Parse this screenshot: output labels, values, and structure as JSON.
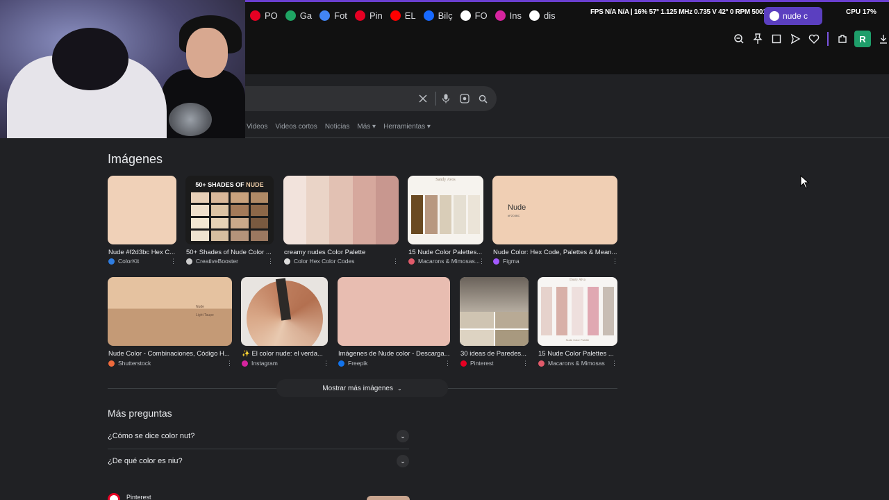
{
  "browser": {
    "bookmarks": [
      {
        "label": "PO",
        "icon": "pinterest-icon",
        "color": "#e60023"
      },
      {
        "label": "Ga",
        "icon": "google-drive-icon",
        "color": "#1fa463"
      },
      {
        "label": "Fot",
        "icon": "google-drive-icon",
        "color": "#4285f4"
      },
      {
        "label": "Pin",
        "icon": "pinterest-icon",
        "color": "#e60023"
      },
      {
        "label": "EL",
        "icon": "youtube-icon",
        "color": "#ff0000"
      },
      {
        "label": "Bilç",
        "icon": "behance-icon",
        "color": "#1769ff"
      },
      {
        "label": "FO",
        "icon": "google-icon",
        "color": "#ffffff"
      },
      {
        "label": "Ins",
        "icon": "instagram-icon",
        "color": "#d6249f"
      },
      {
        "label": "dis",
        "icon": "c-icon",
        "color": "#ffffff"
      }
    ],
    "stats_text": "FPS N/A N/A  |  16% 57°  1.125 MHz 0.735 V 42°  0 RPM 5001 MHz",
    "active_tab_label": "nude c",
    "cpu_text": "CPU 17%",
    "profile_letter": "R"
  },
  "search": {
    "tabs": [
      "Videos",
      "Videos cortos",
      "Noticias",
      "Más ▾",
      "Herramientas ▾"
    ]
  },
  "images_section": {
    "title": "Imágenes",
    "items": [
      {
        "title": "Nude #f2d3bc Hex C...",
        "source": "ColorKit",
        "source_color": "#2f7de1"
      },
      {
        "title": "50+ Shades of Nude Color ...",
        "source": "CreativeBooster",
        "source_color": "#cccccc",
        "overlay_text": "50+ SHADES OF",
        "overlay_highlight": "NUDE"
      },
      {
        "title": "creamy nudes Color Palette",
        "source": "Color Hex Color Codes",
        "source_color": "#dddddd"
      },
      {
        "title": "15 Nude Color Palettes...",
        "source": "Macarons & Mimosas...",
        "source_color": "#e05a6a",
        "overlay_text": "Sandy Avos"
      },
      {
        "title": "Nude Color: Hex Code, Palettes & Mean...",
        "source": "Figma",
        "source_color": "#a259ff",
        "overlay_text": "Nude",
        "overlay_sub": "#F2D3BC"
      },
      {
        "title": "Nude Color - Combinaciones, Código H...",
        "source": "Shutterstock",
        "source_color": "#ee6a3c",
        "overlay_text": "Nude",
        "overlay_sub": "Light Taupe"
      },
      {
        "title": "✨ El color nude: el verda...",
        "source": "Instagram",
        "source_color": "#d6249f"
      },
      {
        "title": "Imágenes de Nude color - Descarga...",
        "source": "Freepik",
        "source_color": "#1273eb"
      },
      {
        "title": "30 ideas de Paredes...",
        "source": "Pinterest",
        "source_color": "#e60023"
      },
      {
        "title": "15 Nude Color Palettes ...",
        "source": "Macarons & Mimosas",
        "source_color": "#e05a6a",
        "overlay_text": "Dusty Alva",
        "overlay_bottom": "Nude Color Palette"
      }
    ],
    "show_more_label": "Mostrar más imágenes"
  },
  "questions": {
    "title": "Más preguntas",
    "items": [
      "¿Cómo se dice color nut?",
      "¿De qué color es niu?"
    ]
  },
  "pinterest_result": {
    "label": "Pinterest"
  }
}
